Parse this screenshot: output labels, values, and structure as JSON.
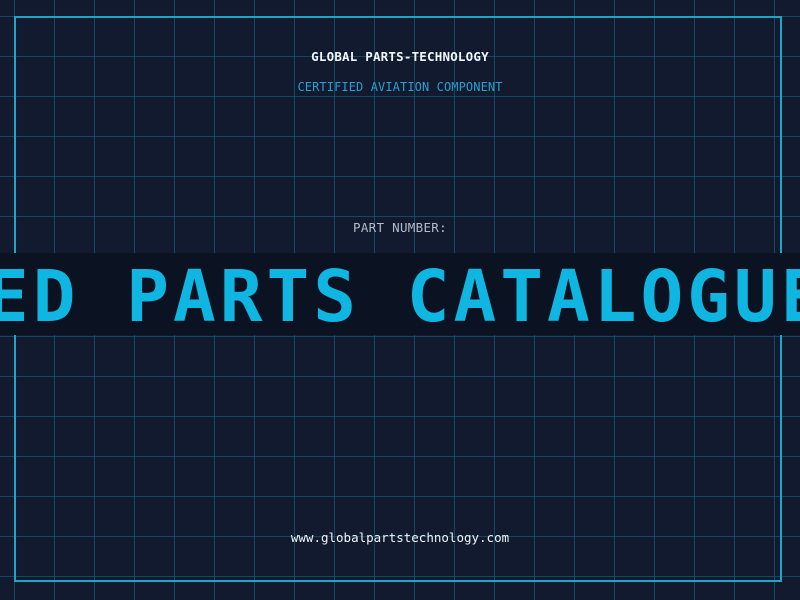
{
  "header": {
    "title": "GLOBAL PARTS-TECHNOLOGY",
    "subtitle": "CERTIFIED AVIATION COMPONENT"
  },
  "part": {
    "label": "PART NUMBER:",
    "value": "ED PARTS CATALOGUE"
  },
  "footer": {
    "url": "www.globalpartstechnology.com"
  },
  "colors": {
    "background": "#111a2e",
    "grid": "#165670",
    "frame": "#1fa6c4",
    "accent": "#10b6e2",
    "band": "#0b1322"
  }
}
